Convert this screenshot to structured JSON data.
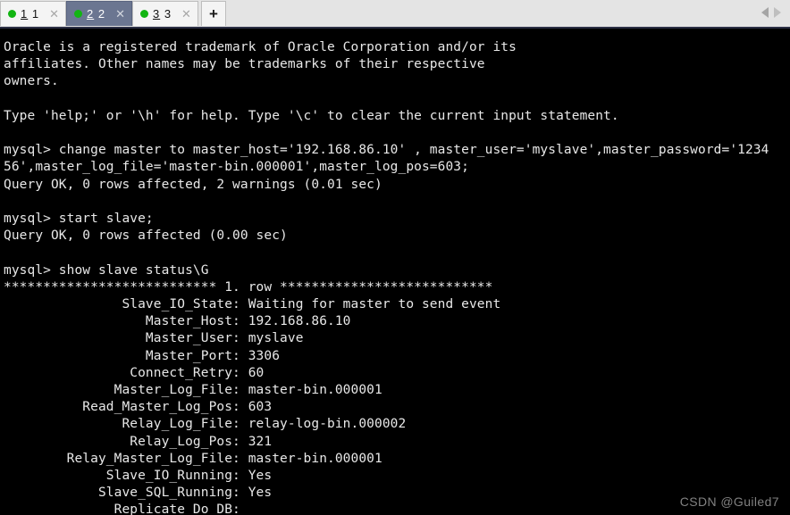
{
  "window": {
    "title": "MySQL command line client",
    "colors": {
      "terminal_bg": "#000000",
      "terminal_fg": "#e8e8e8",
      "tabbar_bg": "#e4e4e4",
      "active_tab_bg": "#6b7691",
      "inactive_tab_bg": "#f4f4f4",
      "status_dot": "#12b512",
      "watermark_fg": "#8d8d8d"
    }
  },
  "tabbar": {
    "tabs": [
      {
        "label": "1 1",
        "mnemonic": "1",
        "rest": " 1",
        "active": false,
        "dot": "session-connected-dot",
        "close_label": "✕"
      },
      {
        "label": "2 2",
        "mnemonic": "2",
        "rest": " 2",
        "active": true,
        "dot": "session-connected-dot",
        "close_label": "✕"
      },
      {
        "label": "3 3",
        "mnemonic": "3",
        "rest": " 3",
        "active": false,
        "dot": "session-connected-dot",
        "close_label": "✕"
      }
    ],
    "new_tab_label": "+",
    "scroll_left_icon": "chevron-left-icon",
    "scroll_right_icon": "chevron-right-icon"
  },
  "terminal": {
    "text": "Oracle is a registered trademark of Oracle Corporation and/or its\naffiliates. Other names may be trademarks of their respective\nowners.\n\nType 'help;' or '\\h' for help. Type '\\c' to clear the current input statement.\n\nmysql> change master to master_host='192.168.86.10' , master_user='myslave',master_password='1234\n56',master_log_file='master-bin.000001',master_log_pos=603;\nQuery OK, 0 rows affected, 2 warnings (0.01 sec)\n\nmysql> start slave;\nQuery OK, 0 rows affected (0.00 sec)\n\nmysql> show slave status\\G\n*************************** 1. row ***************************\n               Slave_IO_State: Waiting for master to send event\n                  Master_Host: 192.168.86.10\n                  Master_User: myslave\n                  Master_Port: 3306\n                Connect_Retry: 60\n              Master_Log_File: master-bin.000001\n          Read_Master_Log_Pos: 603\n               Relay_Log_File: relay-log-bin.000002\n                Relay_Log_Pos: 321\n        Relay_Master_Log_File: master-bin.000001\n             Slave_IO_Running: Yes\n            Slave_SQL_Running: Yes\n              Replicate_Do_DB:",
    "lines": [
      "Oracle is a registered trademark of Oracle Corporation and/or its",
      "affiliates. Other names may be trademarks of their respective",
      "owners.",
      "",
      "Type 'help;' or '\\h' for help. Type '\\c' to clear the current input statement.",
      "",
      "mysql> change master to master_host='192.168.86.10' , master_user='myslave',master_password='1234",
      "56',master_log_file='master-bin.000001',master_log_pos=603;",
      "Query OK, 0 rows affected, 2 warnings (0.01 sec)",
      "",
      "mysql> start slave;",
      "Query OK, 0 rows affected (0.00 sec)",
      "",
      "mysql> show slave status\\G",
      "*************************** 1. row ***************************",
      "               Slave_IO_State: Waiting for master to send event",
      "                  Master_Host: 192.168.86.10",
      "                  Master_User: myslave",
      "                  Master_Port: 3306",
      "                Connect_Retry: 60",
      "              Master_Log_File: master-bin.000001",
      "          Read_Master_Log_Pos: 603",
      "               Relay_Log_File: relay-log-bin.000002",
      "                Relay_Log_Pos: 321",
      "        Relay_Master_Log_File: master-bin.000001",
      "             Slave_IO_Running: Yes",
      "            Slave_SQL_Running: Yes",
      "              Replicate_Do_DB:"
    ],
    "commands": [
      "change master to master_host='192.168.86.10' , master_user='myslave',master_password='123456',master_log_file='master-bin.000001',master_log_pos=603;",
      "start slave;",
      "show slave status\\G"
    ],
    "slave_status": {
      "row_header": "*************************** 1. row ***************************",
      "fields": [
        {
          "name": "Slave_IO_State",
          "value": "Waiting for master to send event"
        },
        {
          "name": "Master_Host",
          "value": "192.168.86.10"
        },
        {
          "name": "Master_User",
          "value": "myslave"
        },
        {
          "name": "Master_Port",
          "value": "3306"
        },
        {
          "name": "Connect_Retry",
          "value": "60"
        },
        {
          "name": "Master_Log_File",
          "value": "master-bin.000001"
        },
        {
          "name": "Read_Master_Log_Pos",
          "value": "603"
        },
        {
          "name": "Relay_Log_File",
          "value": "relay-log-bin.000002"
        },
        {
          "name": "Relay_Log_Pos",
          "value": "321"
        },
        {
          "name": "Relay_Master_Log_File",
          "value": "master-bin.000001"
        },
        {
          "name": "Slave_IO_Running",
          "value": "Yes"
        },
        {
          "name": "Slave_SQL_Running",
          "value": "Yes"
        },
        {
          "name": "Replicate_Do_DB",
          "value": ""
        }
      ]
    },
    "prompt": "mysql>"
  },
  "watermark": {
    "text": "CSDN @Guiled7"
  }
}
